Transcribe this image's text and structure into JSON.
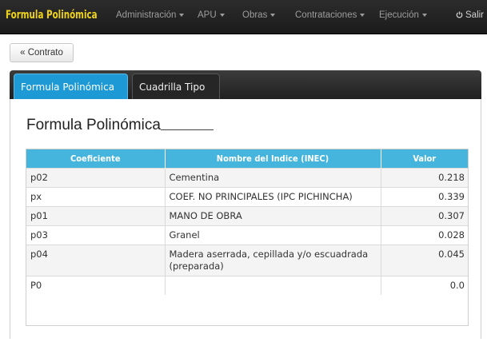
{
  "navbar": {
    "brand": "Formula Polinómica",
    "items": [
      {
        "label": "Administración"
      },
      {
        "label": "APU"
      },
      {
        "label": "Obras"
      },
      {
        "label": "Contrataciones"
      },
      {
        "label": "Ejecución"
      }
    ],
    "exit_label": "Salir",
    "brand_color": "#f0d31a"
  },
  "back_button": {
    "label": "« Contrato"
  },
  "tabs": [
    {
      "label": "Formula Polinómica",
      "active": true
    },
    {
      "label": "Cuadrilla Tipo",
      "active": false
    }
  ],
  "section": {
    "title": "Formula Polinómica"
  },
  "table": {
    "headers": [
      "Coeficiente",
      "Nombre del Indice (INEC)",
      "Valor"
    ],
    "header_color": "#45b5dd",
    "rows": [
      {
        "coef": "p02",
        "name": "Cementina",
        "value": "0.218"
      },
      {
        "coef": "px",
        "name": "COEF. NO PRINCIPALES (IPC PICHINCHA)",
        "value": "0.339"
      },
      {
        "coef": "p01",
        "name": "MANO DE OBRA",
        "value": "0.307"
      },
      {
        "coef": "p03",
        "name": "Granel",
        "value": "0.028"
      },
      {
        "coef": "p04",
        "name": "Madera aserrada, cepillada y/o escuadrada (preparada)",
        "value": "0.045"
      },
      {
        "coef": "P0",
        "name": "",
        "value": "0.0"
      }
    ]
  }
}
